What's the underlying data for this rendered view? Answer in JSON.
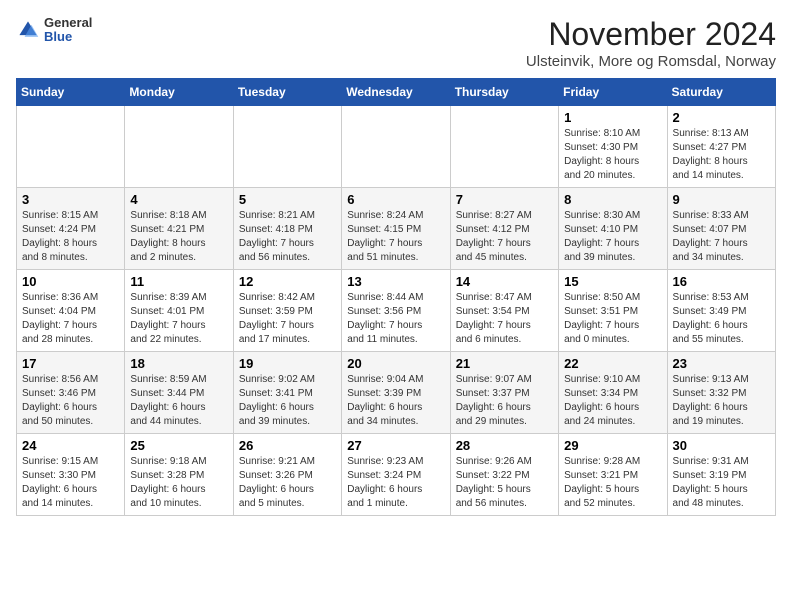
{
  "header": {
    "logo_general": "General",
    "logo_blue": "Blue",
    "month_title": "November 2024",
    "location": "Ulsteinvik, More og Romsdal, Norway"
  },
  "weekdays": [
    "Sunday",
    "Monday",
    "Tuesday",
    "Wednesday",
    "Thursday",
    "Friday",
    "Saturday"
  ],
  "weeks": [
    [
      {
        "day": "",
        "info": ""
      },
      {
        "day": "",
        "info": ""
      },
      {
        "day": "",
        "info": ""
      },
      {
        "day": "",
        "info": ""
      },
      {
        "day": "",
        "info": ""
      },
      {
        "day": "1",
        "info": "Sunrise: 8:10 AM\nSunset: 4:30 PM\nDaylight: 8 hours\nand 20 minutes."
      },
      {
        "day": "2",
        "info": "Sunrise: 8:13 AM\nSunset: 4:27 PM\nDaylight: 8 hours\nand 14 minutes."
      }
    ],
    [
      {
        "day": "3",
        "info": "Sunrise: 8:15 AM\nSunset: 4:24 PM\nDaylight: 8 hours\nand 8 minutes."
      },
      {
        "day": "4",
        "info": "Sunrise: 8:18 AM\nSunset: 4:21 PM\nDaylight: 8 hours\nand 2 minutes."
      },
      {
        "day": "5",
        "info": "Sunrise: 8:21 AM\nSunset: 4:18 PM\nDaylight: 7 hours\nand 56 minutes."
      },
      {
        "day": "6",
        "info": "Sunrise: 8:24 AM\nSunset: 4:15 PM\nDaylight: 7 hours\nand 51 minutes."
      },
      {
        "day": "7",
        "info": "Sunrise: 8:27 AM\nSunset: 4:12 PM\nDaylight: 7 hours\nand 45 minutes."
      },
      {
        "day": "8",
        "info": "Sunrise: 8:30 AM\nSunset: 4:10 PM\nDaylight: 7 hours\nand 39 minutes."
      },
      {
        "day": "9",
        "info": "Sunrise: 8:33 AM\nSunset: 4:07 PM\nDaylight: 7 hours\nand 34 minutes."
      }
    ],
    [
      {
        "day": "10",
        "info": "Sunrise: 8:36 AM\nSunset: 4:04 PM\nDaylight: 7 hours\nand 28 minutes."
      },
      {
        "day": "11",
        "info": "Sunrise: 8:39 AM\nSunset: 4:01 PM\nDaylight: 7 hours\nand 22 minutes."
      },
      {
        "day": "12",
        "info": "Sunrise: 8:42 AM\nSunset: 3:59 PM\nDaylight: 7 hours\nand 17 minutes."
      },
      {
        "day": "13",
        "info": "Sunrise: 8:44 AM\nSunset: 3:56 PM\nDaylight: 7 hours\nand 11 minutes."
      },
      {
        "day": "14",
        "info": "Sunrise: 8:47 AM\nSunset: 3:54 PM\nDaylight: 7 hours\nand 6 minutes."
      },
      {
        "day": "15",
        "info": "Sunrise: 8:50 AM\nSunset: 3:51 PM\nDaylight: 7 hours\nand 0 minutes."
      },
      {
        "day": "16",
        "info": "Sunrise: 8:53 AM\nSunset: 3:49 PM\nDaylight: 6 hours\nand 55 minutes."
      }
    ],
    [
      {
        "day": "17",
        "info": "Sunrise: 8:56 AM\nSunset: 3:46 PM\nDaylight: 6 hours\nand 50 minutes."
      },
      {
        "day": "18",
        "info": "Sunrise: 8:59 AM\nSunset: 3:44 PM\nDaylight: 6 hours\nand 44 minutes."
      },
      {
        "day": "19",
        "info": "Sunrise: 9:02 AM\nSunset: 3:41 PM\nDaylight: 6 hours\nand 39 minutes."
      },
      {
        "day": "20",
        "info": "Sunrise: 9:04 AM\nSunset: 3:39 PM\nDaylight: 6 hours\nand 34 minutes."
      },
      {
        "day": "21",
        "info": "Sunrise: 9:07 AM\nSunset: 3:37 PM\nDaylight: 6 hours\nand 29 minutes."
      },
      {
        "day": "22",
        "info": "Sunrise: 9:10 AM\nSunset: 3:34 PM\nDaylight: 6 hours\nand 24 minutes."
      },
      {
        "day": "23",
        "info": "Sunrise: 9:13 AM\nSunset: 3:32 PM\nDaylight: 6 hours\nand 19 minutes."
      }
    ],
    [
      {
        "day": "24",
        "info": "Sunrise: 9:15 AM\nSunset: 3:30 PM\nDaylight: 6 hours\nand 14 minutes."
      },
      {
        "day": "25",
        "info": "Sunrise: 9:18 AM\nSunset: 3:28 PM\nDaylight: 6 hours\nand 10 minutes."
      },
      {
        "day": "26",
        "info": "Sunrise: 9:21 AM\nSunset: 3:26 PM\nDaylight: 6 hours\nand 5 minutes."
      },
      {
        "day": "27",
        "info": "Sunrise: 9:23 AM\nSunset: 3:24 PM\nDaylight: 6 hours\nand 1 minute."
      },
      {
        "day": "28",
        "info": "Sunrise: 9:26 AM\nSunset: 3:22 PM\nDaylight: 5 hours\nand 56 minutes."
      },
      {
        "day": "29",
        "info": "Sunrise: 9:28 AM\nSunset: 3:21 PM\nDaylight: 5 hours\nand 52 minutes."
      },
      {
        "day": "30",
        "info": "Sunrise: 9:31 AM\nSunset: 3:19 PM\nDaylight: 5 hours\nand 48 minutes."
      }
    ]
  ]
}
